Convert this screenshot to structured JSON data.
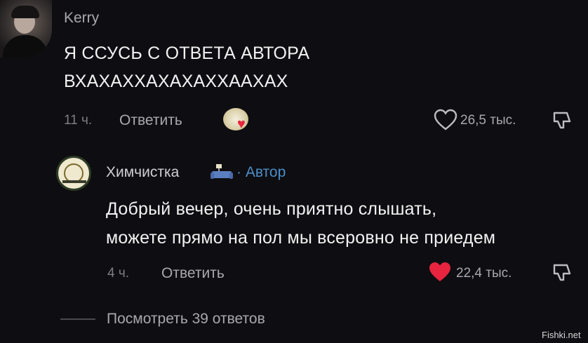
{
  "comments": [
    {
      "username": "Kerry",
      "text_line1": "Я ССУСЬ С ОТВЕТА АВТОРА",
      "text_line2": "ВХАХАХХАХАХАХХААХАХ",
      "time": "11 ч.",
      "reply_label": "Ответить",
      "likes": "26,5 тыс.",
      "liked": false
    },
    {
      "username": "Химчистка",
      "author_badge": "· Автор",
      "text_line1": "Добрый вечер, очень приятно слышать,",
      "text_line2": "можете прямо на пол мы всеровно не приедем",
      "time": "4 ч.",
      "reply_label": "Ответить",
      "likes": "22,4 тыс.",
      "liked": true
    }
  ],
  "view_replies": "Посмотреть 39 ответов",
  "watermark": "Fishki.net",
  "colors": {
    "background": "#0e0d11",
    "like_active": "#e8243f",
    "author_badge": "#4b8ec8"
  },
  "icons": [
    "heart-outline-icon",
    "heart-filled-icon",
    "dislike-icon",
    "sofa-emoji-icon",
    "sticker-icon"
  ]
}
